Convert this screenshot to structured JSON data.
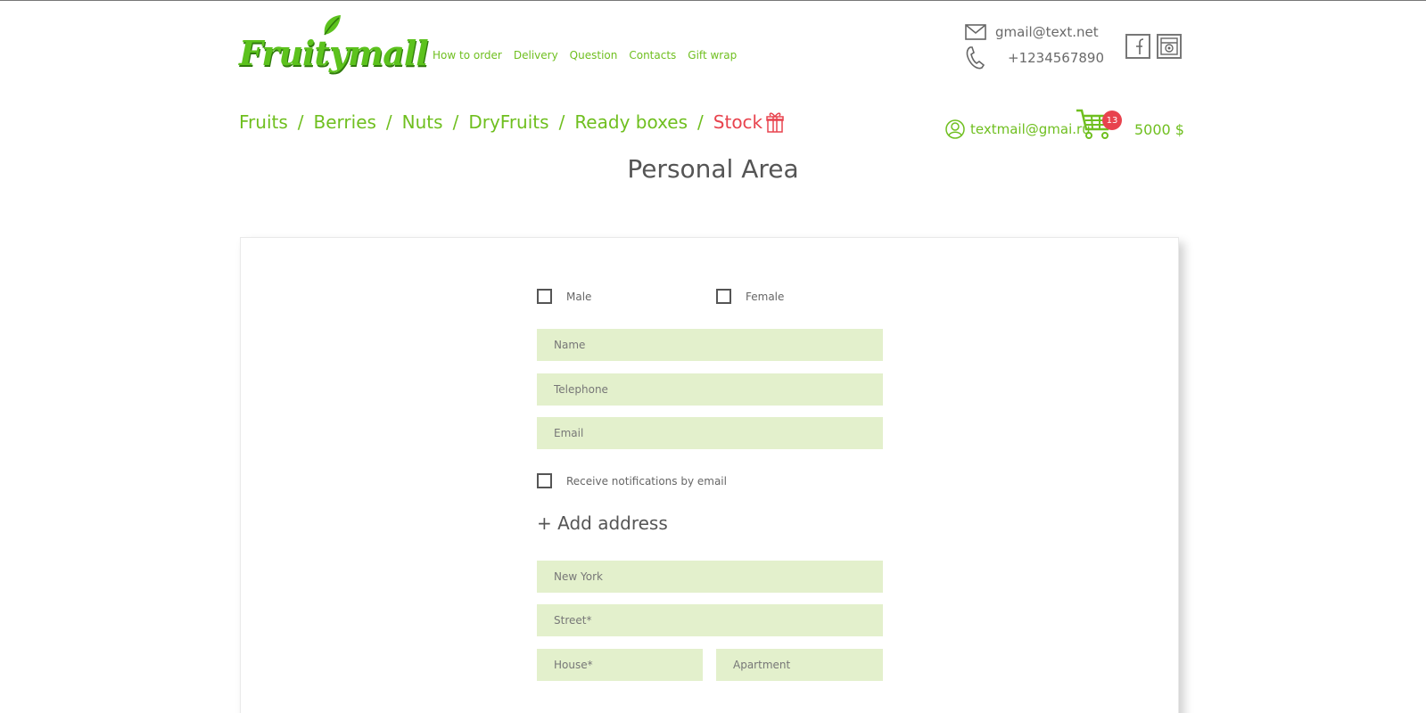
{
  "brand": {
    "logo_text": "Fruitymall"
  },
  "top_nav": [
    "How to order",
    "Delivery",
    "Question",
    "Contacts",
    "Gift wrap"
  ],
  "contacts": {
    "email": "gmail@text.net",
    "phone": "+1234567890"
  },
  "categories": [
    "Fruits",
    "Berries",
    "Nuts",
    "DryFruits",
    "Ready boxes"
  ],
  "category_separator": "/",
  "stock_label": "Stock",
  "user": {
    "email": "textmail@gmai.ru"
  },
  "cart": {
    "count": "13",
    "total": "5000 $"
  },
  "page_title": "Personal Area",
  "form": {
    "gender_male": "Male",
    "gender_female": "Female",
    "name_placeholder": "Name",
    "telephone_placeholder": "Telephone",
    "email_placeholder": "Email",
    "notifications_label": "Receive notifications by email",
    "add_address_label": "+ Add address",
    "city_value": "New York",
    "street_placeholder": "Street*",
    "house_placeholder": "House*",
    "apartment_placeholder": "Apartment"
  },
  "colors": {
    "accent_green": "#6fbf1f",
    "stock_red": "#e8434e",
    "field_bg": "#e3f0cc"
  }
}
